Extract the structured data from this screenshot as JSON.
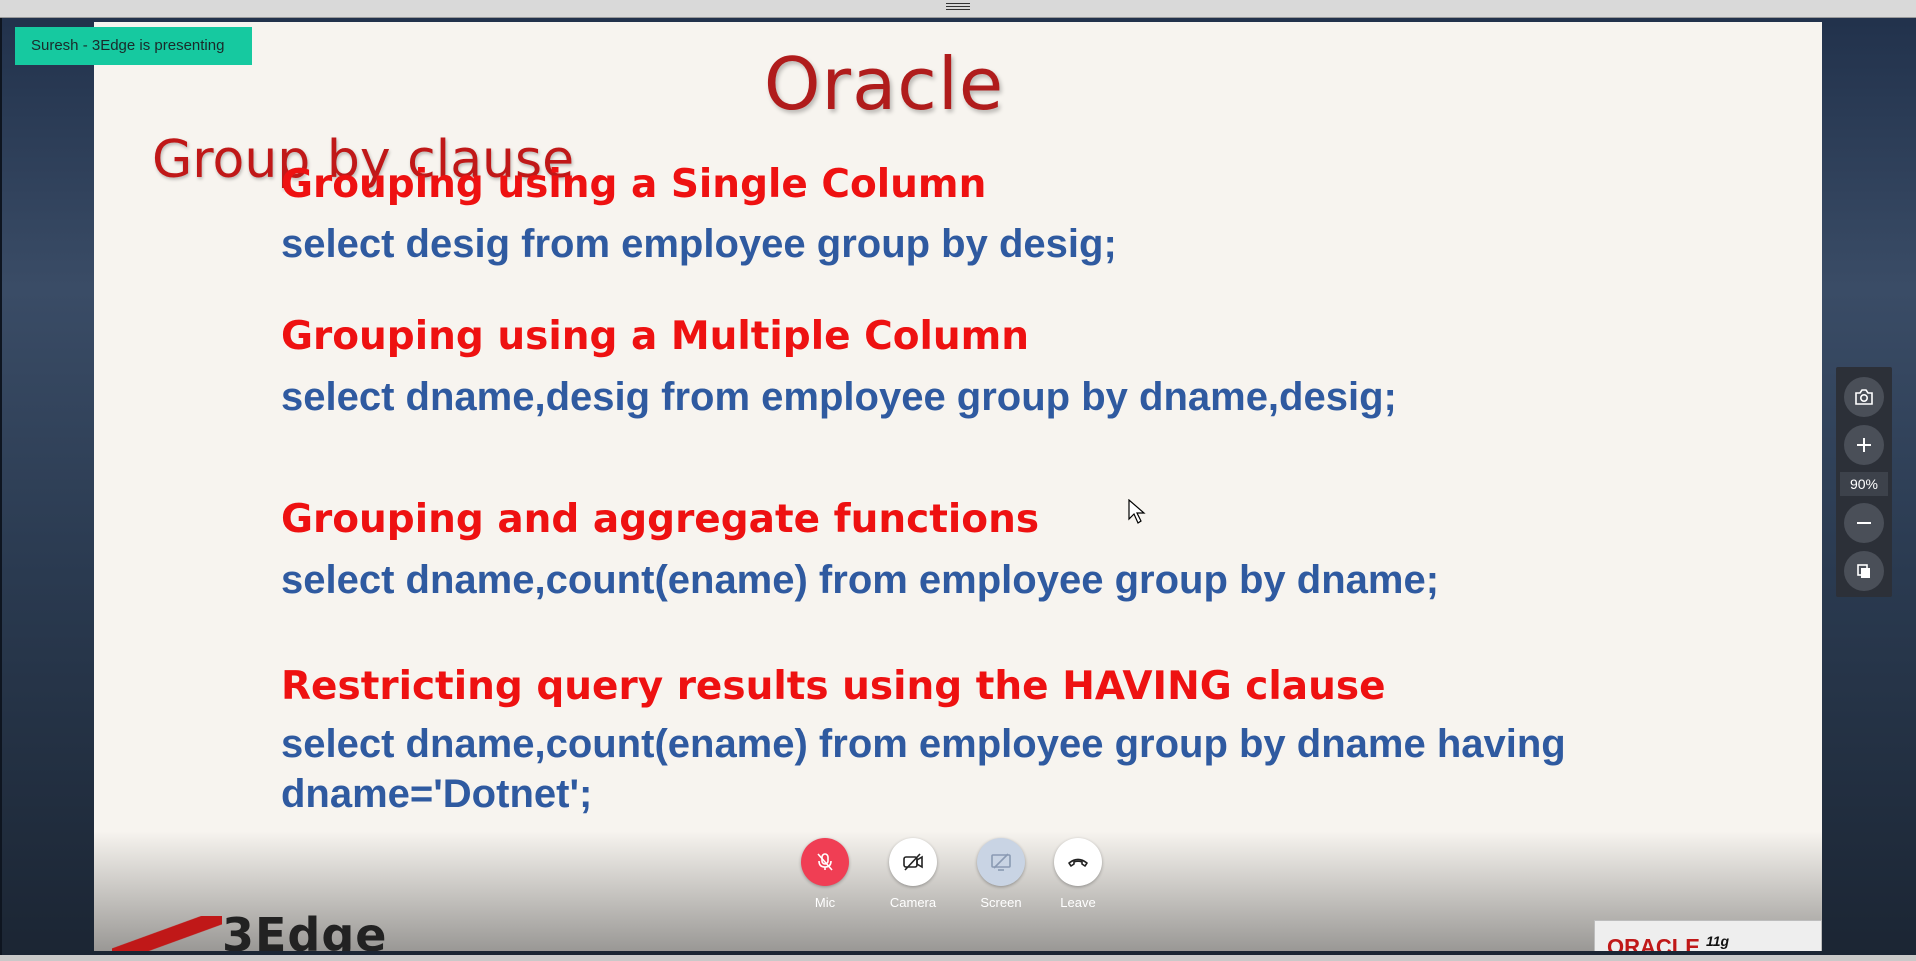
{
  "presenter_banner": "Suresh - 3Edge is presenting",
  "slide": {
    "title": "Oracle",
    "section": "Group by clause",
    "items": [
      {
        "heading": "Grouping using a Single Column",
        "code": "select desig from employee group by desig;"
      },
      {
        "heading": "Grouping using a Multiple Column",
        "code": "select dname,desig from employee group by dname,desig;"
      },
      {
        "heading": "Grouping and aggregate functions",
        "code": "select dname,count(ename) from employee group by dname;"
      },
      {
        "heading": "Restricting query results using the HAVING clause",
        "code_line1": "select dname,count(ename) from employee group by dname having",
        "code_line2": "dname='Dotnet';"
      }
    ],
    "logo_left": "3Edge",
    "logo_right": "ORACLE",
    "logo_right_version": "11g"
  },
  "controls": {
    "mic": "Mic",
    "camera": "Camera",
    "screen": "Screen",
    "leave": "Leave"
  },
  "zoom": {
    "level": "90%"
  },
  "icons": {
    "mic": "mic-off-icon",
    "camera": "camera-off-icon",
    "screen": "screen-share-icon",
    "leave": "hang-up-icon",
    "snapshot": "camera-snapshot-icon",
    "zoom_in": "plus-icon",
    "zoom_out": "minus-icon",
    "copy": "copy-icon"
  },
  "colors": {
    "banner": "#16c9a0",
    "mic_button": "#f03e54",
    "heading_red": "#ee1111",
    "code_blue": "#2f5aa0"
  }
}
